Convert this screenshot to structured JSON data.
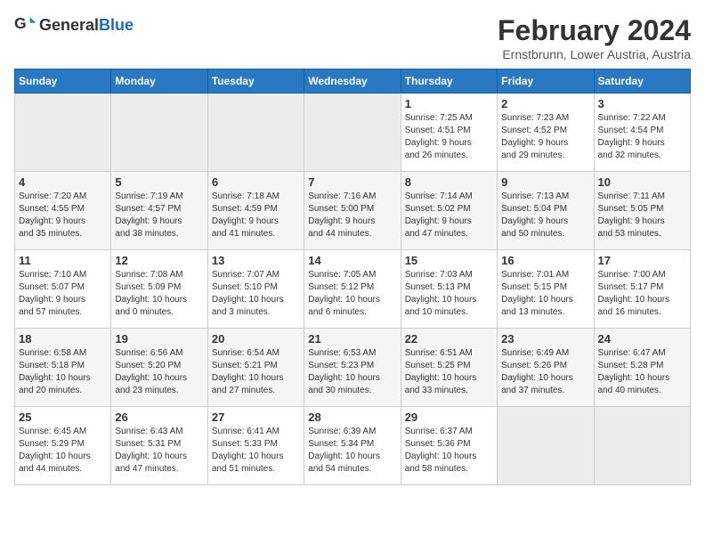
{
  "header": {
    "logo_general": "General",
    "logo_blue": "Blue",
    "month_year": "February 2024",
    "location": "Ernstbrunn, Lower Austria, Austria"
  },
  "weekdays": [
    "Sunday",
    "Monday",
    "Tuesday",
    "Wednesday",
    "Thursday",
    "Friday",
    "Saturday"
  ],
  "weeks": [
    {
      "days": [
        {
          "num": "",
          "info": "",
          "empty": true
        },
        {
          "num": "",
          "info": "",
          "empty": true
        },
        {
          "num": "",
          "info": "",
          "empty": true
        },
        {
          "num": "",
          "info": "",
          "empty": true
        },
        {
          "num": "1",
          "info": "Sunrise: 7:25 AM\nSunset: 4:51 PM\nDaylight: 9 hours\nand 26 minutes.",
          "empty": false
        },
        {
          "num": "2",
          "info": "Sunrise: 7:23 AM\nSunset: 4:52 PM\nDaylight: 9 hours\nand 29 minutes.",
          "empty": false
        },
        {
          "num": "3",
          "info": "Sunrise: 7:22 AM\nSunset: 4:54 PM\nDaylight: 9 hours\nand 32 minutes.",
          "empty": false
        }
      ]
    },
    {
      "days": [
        {
          "num": "4",
          "info": "Sunrise: 7:20 AM\nSunset: 4:55 PM\nDaylight: 9 hours\nand 35 minutes.",
          "empty": false
        },
        {
          "num": "5",
          "info": "Sunrise: 7:19 AM\nSunset: 4:57 PM\nDaylight: 9 hours\nand 38 minutes.",
          "empty": false
        },
        {
          "num": "6",
          "info": "Sunrise: 7:18 AM\nSunset: 4:59 PM\nDaylight: 9 hours\nand 41 minutes.",
          "empty": false
        },
        {
          "num": "7",
          "info": "Sunrise: 7:16 AM\nSunset: 5:00 PM\nDaylight: 9 hours\nand 44 minutes.",
          "empty": false
        },
        {
          "num": "8",
          "info": "Sunrise: 7:14 AM\nSunset: 5:02 PM\nDaylight: 9 hours\nand 47 minutes.",
          "empty": false
        },
        {
          "num": "9",
          "info": "Sunrise: 7:13 AM\nSunset: 5:04 PM\nDaylight: 9 hours\nand 50 minutes.",
          "empty": false
        },
        {
          "num": "10",
          "info": "Sunrise: 7:11 AM\nSunset: 5:05 PM\nDaylight: 9 hours\nand 53 minutes.",
          "empty": false
        }
      ]
    },
    {
      "days": [
        {
          "num": "11",
          "info": "Sunrise: 7:10 AM\nSunset: 5:07 PM\nDaylight: 9 hours\nand 57 minutes.",
          "empty": false
        },
        {
          "num": "12",
          "info": "Sunrise: 7:08 AM\nSunset: 5:09 PM\nDaylight: 10 hours\nand 0 minutes.",
          "empty": false
        },
        {
          "num": "13",
          "info": "Sunrise: 7:07 AM\nSunset: 5:10 PM\nDaylight: 10 hours\nand 3 minutes.",
          "empty": false
        },
        {
          "num": "14",
          "info": "Sunrise: 7:05 AM\nSunset: 5:12 PM\nDaylight: 10 hours\nand 6 minutes.",
          "empty": false
        },
        {
          "num": "15",
          "info": "Sunrise: 7:03 AM\nSunset: 5:13 PM\nDaylight: 10 hours\nand 10 minutes.",
          "empty": false
        },
        {
          "num": "16",
          "info": "Sunrise: 7:01 AM\nSunset: 5:15 PM\nDaylight: 10 hours\nand 13 minutes.",
          "empty": false
        },
        {
          "num": "17",
          "info": "Sunrise: 7:00 AM\nSunset: 5:17 PM\nDaylight: 10 hours\nand 16 minutes.",
          "empty": false
        }
      ]
    },
    {
      "days": [
        {
          "num": "18",
          "info": "Sunrise: 6:58 AM\nSunset: 5:18 PM\nDaylight: 10 hours\nand 20 minutes.",
          "empty": false
        },
        {
          "num": "19",
          "info": "Sunrise: 6:56 AM\nSunset: 5:20 PM\nDaylight: 10 hours\nand 23 minutes.",
          "empty": false
        },
        {
          "num": "20",
          "info": "Sunrise: 6:54 AM\nSunset: 5:21 PM\nDaylight: 10 hours\nand 27 minutes.",
          "empty": false
        },
        {
          "num": "21",
          "info": "Sunrise: 6:53 AM\nSunset: 5:23 PM\nDaylight: 10 hours\nand 30 minutes.",
          "empty": false
        },
        {
          "num": "22",
          "info": "Sunrise: 6:51 AM\nSunset: 5:25 PM\nDaylight: 10 hours\nand 33 minutes.",
          "empty": false
        },
        {
          "num": "23",
          "info": "Sunrise: 6:49 AM\nSunset: 5:26 PM\nDaylight: 10 hours\nand 37 minutes.",
          "empty": false
        },
        {
          "num": "24",
          "info": "Sunrise: 6:47 AM\nSunset: 5:28 PM\nDaylight: 10 hours\nand 40 minutes.",
          "empty": false
        }
      ]
    },
    {
      "days": [
        {
          "num": "25",
          "info": "Sunrise: 6:45 AM\nSunset: 5:29 PM\nDaylight: 10 hours\nand 44 minutes.",
          "empty": false
        },
        {
          "num": "26",
          "info": "Sunrise: 6:43 AM\nSunset: 5:31 PM\nDaylight: 10 hours\nand 47 minutes.",
          "empty": false
        },
        {
          "num": "27",
          "info": "Sunrise: 6:41 AM\nSunset: 5:33 PM\nDaylight: 10 hours\nand 51 minutes.",
          "empty": false
        },
        {
          "num": "28",
          "info": "Sunrise: 6:39 AM\nSunset: 5:34 PM\nDaylight: 10 hours\nand 54 minutes.",
          "empty": false
        },
        {
          "num": "29",
          "info": "Sunrise: 6:37 AM\nSunset: 5:36 PM\nDaylight: 10 hours\nand 58 minutes.",
          "empty": false
        },
        {
          "num": "",
          "info": "",
          "empty": true
        },
        {
          "num": "",
          "info": "",
          "empty": true
        }
      ]
    }
  ]
}
